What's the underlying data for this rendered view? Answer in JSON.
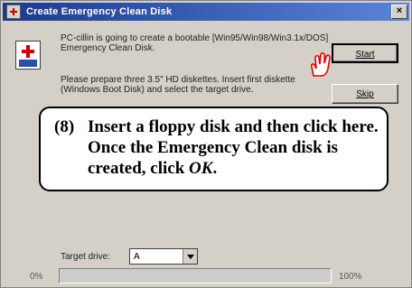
{
  "window": {
    "title": "Create Emergency Clean Disk",
    "close_label": "×"
  },
  "content": {
    "paragraph1": "PC-cillin is going to create a bootable [Win95/Win98/Win3.1x/DOS] Emergency Clean Disk.",
    "paragraph2": "Please prepare three 3.5\" HD diskettes. Insert first diskette (Windows Boot Disk) and select the target drive."
  },
  "buttons": {
    "start_label": "Start",
    "skip_label": "Skip"
  },
  "callout": {
    "number": "(8)",
    "text_part1": "Insert a floppy disk and then click here. Once the Emergency Clean disk is created, click ",
    "text_emphasis": "OK",
    "text_part2": "."
  },
  "target": {
    "label": "Target drive:",
    "value": "A"
  },
  "progress": {
    "start_label": "0%",
    "end_label": "100%",
    "value": 0
  },
  "icons": {
    "title": "medical-cross-icon",
    "app": "emergency-disk-icon",
    "cursor": "hand-pointer-icon"
  }
}
